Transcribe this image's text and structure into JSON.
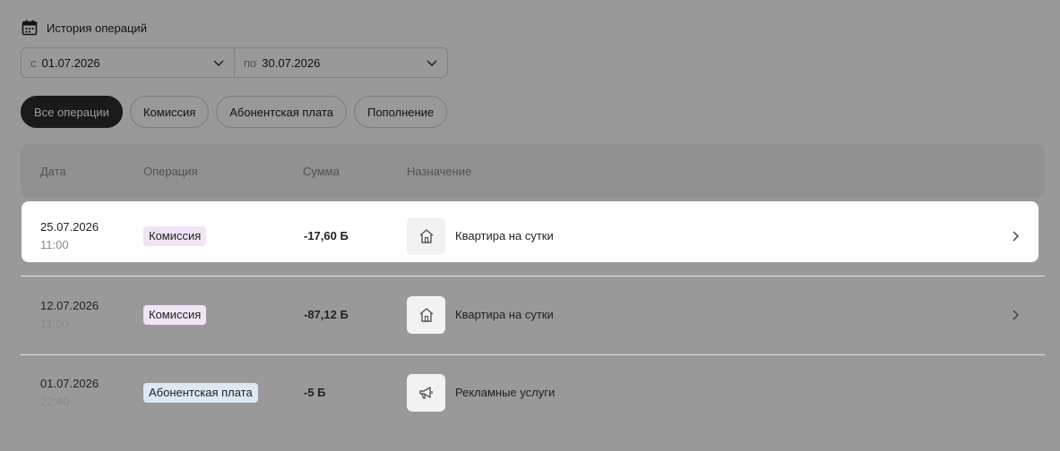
{
  "header": {
    "title": "История операций",
    "icon": "calendar-icon"
  },
  "date_range": {
    "from_prefix": "с",
    "from_value": "01.07.2026",
    "to_prefix": "по",
    "to_value": "30.07.2026"
  },
  "filters": [
    {
      "label": "Все операции",
      "active": true
    },
    {
      "label": "Комиссия",
      "active": false
    },
    {
      "label": "Абонентская плата",
      "active": false
    },
    {
      "label": "Пополнение",
      "active": false
    }
  ],
  "table": {
    "columns": [
      "Дата",
      "Операция",
      "Сумма",
      "Назначение"
    ],
    "rows": [
      {
        "date": "25.07.2026",
        "time": "11:00",
        "operation": "Комиссия",
        "badge_color": "#f1e4f6",
        "amount": "-17,60 Б",
        "purpose": "Квартира на сутки",
        "icon": "house-icon",
        "highlighted": true
      },
      {
        "date": "12.07.2026",
        "time": "11:00",
        "operation": "Комиссия",
        "badge_color": "#f1e4f6",
        "amount": "-87,12 Б",
        "purpose": "Квартира на сутки",
        "icon": "house-icon",
        "highlighted": false
      },
      {
        "date": "01.07.2026",
        "time": "22:40",
        "operation": "Абонентская плата",
        "badge_color": "#dce9f4",
        "amount": "-5 Б",
        "purpose": "Рекламные услуги",
        "icon": "megaphone-icon",
        "highlighted": false
      }
    ]
  },
  "colors": {
    "overlay": "rgba(0,0,0,0.40)",
    "active_chip": "#2c2c2c"
  }
}
